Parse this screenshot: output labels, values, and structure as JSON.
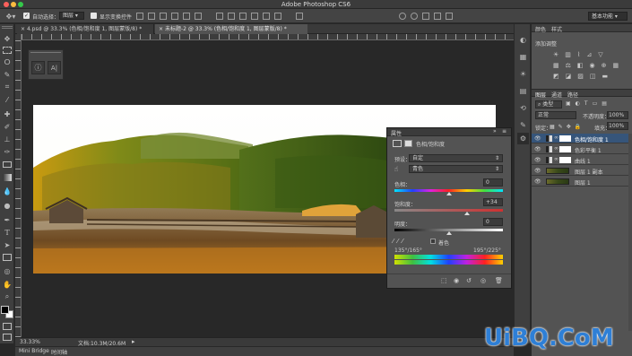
{
  "app": {
    "title": "Adobe Photoshop CS6",
    "workspace": "基本功能"
  },
  "options_bar": {
    "auto_select_label": "自动选择：",
    "auto_select_value": "图层",
    "transform_controls_label": "显示变换控件"
  },
  "tabs": [
    {
      "label": "4.psd @ 33.3% (色相/饱和度 1, 图层蒙版/8) *",
      "active": false
    },
    {
      "label": "未标题-2 @ 33.3% (色相/饱和度 1, 图层蒙版/8) *",
      "active": true
    }
  ],
  "status_bar": {
    "zoom": "33.33%",
    "doc": "文档:10.3M/20.6M"
  },
  "bottom_tabs": [
    "Mini Bridge",
    "时间轴"
  ],
  "properties": {
    "title": "属性",
    "subtitle": "色相/饱和度",
    "preset_label": "预设：",
    "preset_value": "自定",
    "channel_value": "青色",
    "hue_label": "色相：",
    "hue_value": "0",
    "saturation_label": "饱和度：",
    "saturation_value": "+34",
    "lightness_label": "明度：",
    "lightness_value": "0",
    "hue_slider": 0.5,
    "saturation_slider": 0.67,
    "lightness_slider": 0.5,
    "colorize_label": "着色",
    "range_left": "135°/165°",
    "range_right": "195°/225°"
  },
  "right_panel": {
    "tabs": [
      "颜色",
      "样式"
    ],
    "adjust_title": "添加调整"
  },
  "layers_panel": {
    "tabs": [
      "图层",
      "通道",
      "路径"
    ],
    "kind_value": "类型",
    "blend_mode": "正常",
    "opacity_label": "不透明度：",
    "opacity_value": "100%",
    "lock_label": "锁定：",
    "fill_label": "填充：",
    "fill_value": "100%",
    "layers": [
      {
        "name": "色相/饱和度 1",
        "selected": true,
        "adjustment": true
      },
      {
        "name": "色彩平衡 1",
        "selected": false,
        "adjustment": true
      },
      {
        "name": "曲线 1",
        "selected": false,
        "adjustment": true
      },
      {
        "name": "图层 1 副本",
        "selected": false,
        "adjustment": false
      },
      {
        "name": "图层 1",
        "selected": false,
        "adjustment": false
      }
    ]
  },
  "watermark": {
    "text": "UiBQ.CoM"
  },
  "colors": {
    "panel": "#535353",
    "dark": "#282828",
    "selected": "#36557a",
    "accent": "#2b72c9"
  }
}
